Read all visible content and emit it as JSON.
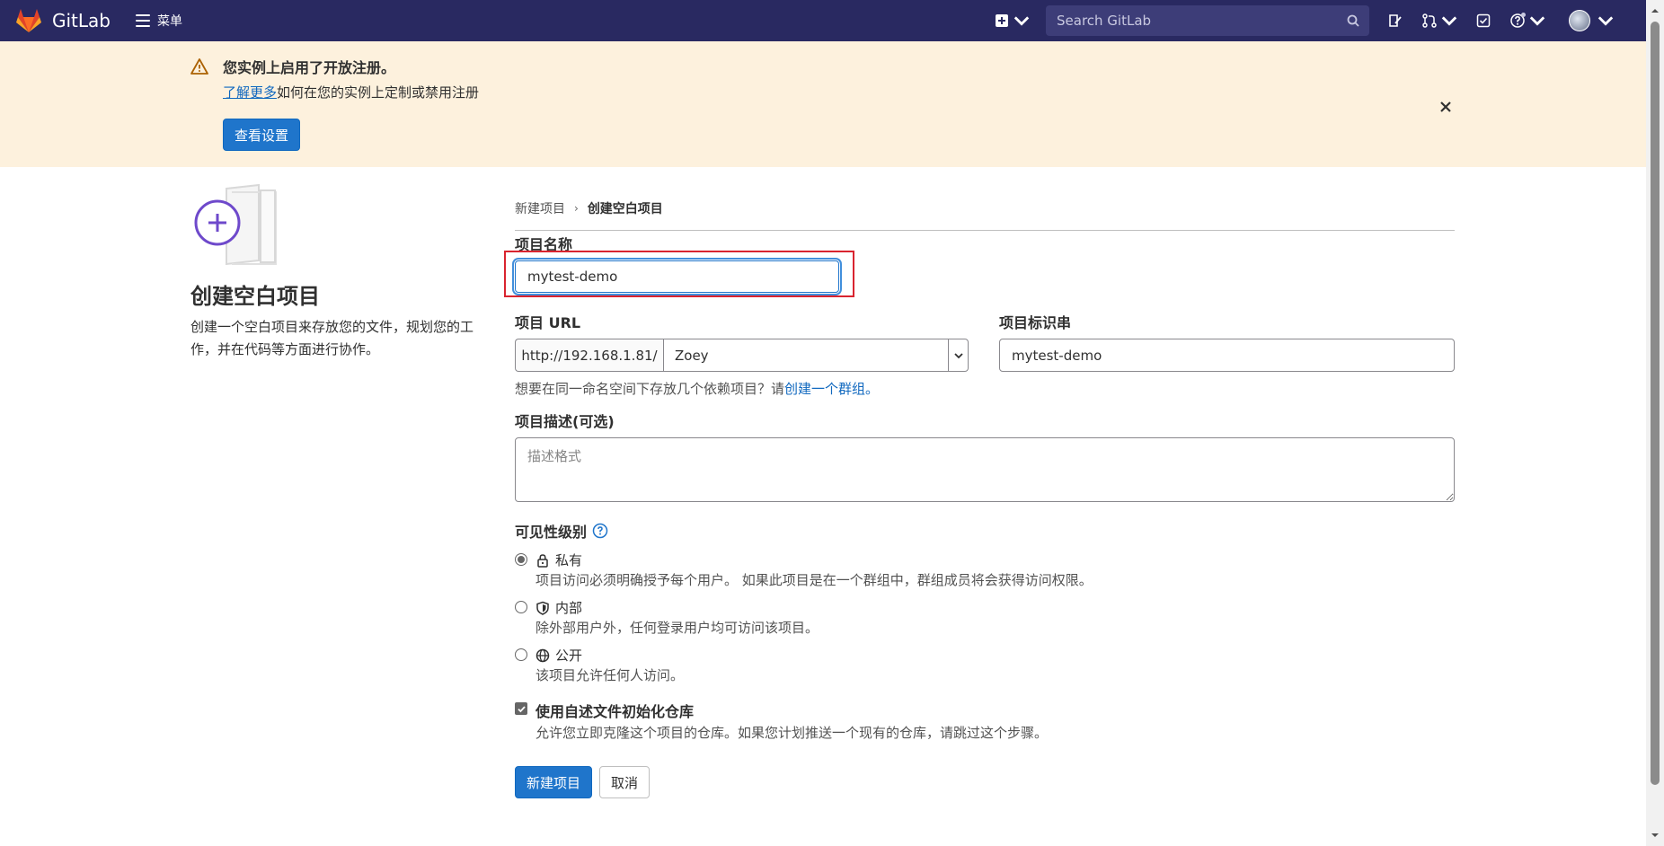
{
  "navbar": {
    "brand": "GitLab",
    "menu_label": "菜单",
    "search_placeholder": "Search GitLab"
  },
  "banner": {
    "title": "您实例上启用了开放注册。",
    "link_text": "了解更多",
    "line_rest": "如何在您的实例上定制或禁用注册",
    "button": "查看设置"
  },
  "left": {
    "title": "创建空白项目",
    "description": "创建一个空白项目来存放您的文件，规划您的工作，并在代码等方面进行协作。"
  },
  "breadcrumb": {
    "parent": "新建项目",
    "current": "创建空白项目"
  },
  "form": {
    "name_label": "项目名称",
    "name_value": "mytest-demo",
    "url_label": "项目 URL",
    "url_prefix": "http://192.168.1.81/",
    "namespace": "Zoey",
    "slug_label": "项目标识串",
    "slug_value": "mytest-demo",
    "hint_text": "想要在同一命名空间下存放几个依赖项目？请",
    "hint_link": "创建一个群组。",
    "desc_label": "项目描述(可选)",
    "desc_placeholder": "描述格式",
    "visibility_label": "可见性级别",
    "visibility_options": [
      {
        "title": "私有",
        "desc": "项目访问必须明确授予每个用户。 如果此项目是在一个群组中，群组成员将会获得访问权限。",
        "checked": true
      },
      {
        "title": "内部",
        "desc": "除外部用户外，任何登录用户均可访问该项目。",
        "checked": false
      },
      {
        "title": "公开",
        "desc": "该项目允许任何人访问。",
        "checked": false
      }
    ],
    "readme_title": "使用自述文件初始化仓库",
    "readme_desc": "允许您立即克隆这个项目的仓库。如果您计划推送一个现有的仓库，请跳过这个步骤。",
    "readme_checked": true,
    "submit": "新建项目",
    "cancel": "取消"
  },
  "colors": {
    "navbar_bg": "#292961",
    "banner_bg": "#fdf1dd",
    "primary": "#1f75cb",
    "highlight_border": "#d9242f",
    "link": "#1068bf"
  }
}
